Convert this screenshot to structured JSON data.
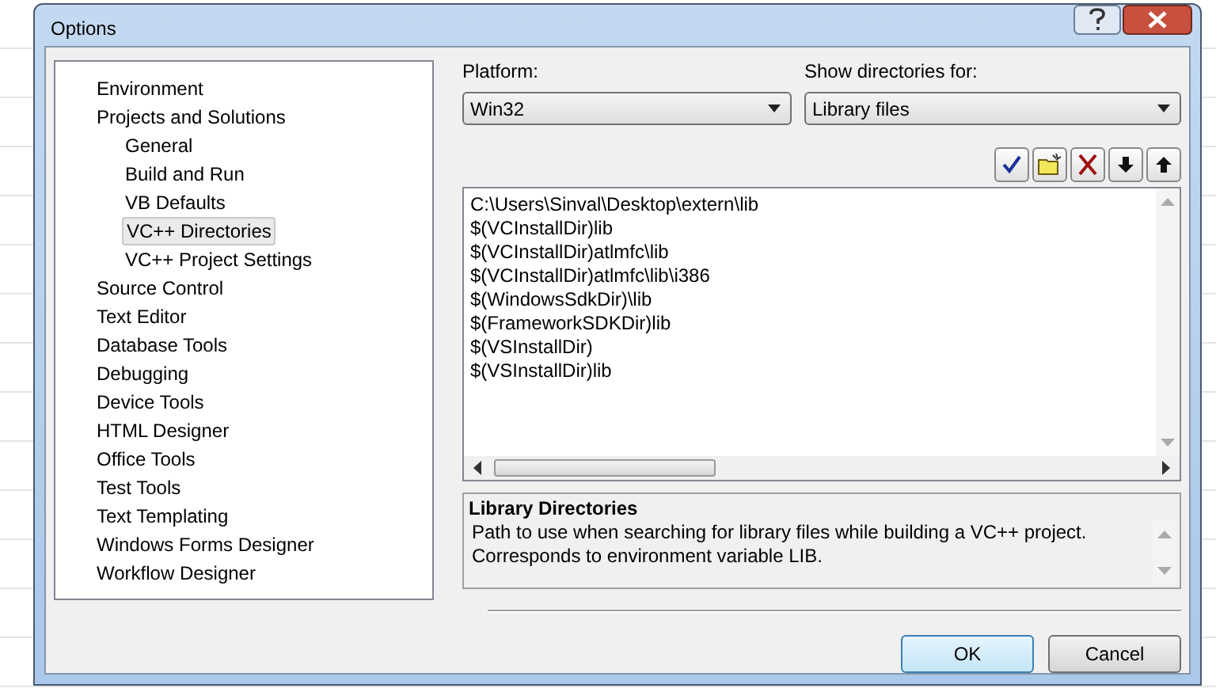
{
  "window": {
    "title": "Options"
  },
  "tree": [
    {
      "label": "Environment",
      "selected": false
    },
    {
      "label": "Projects and Solutions",
      "selected": false,
      "children": [
        {
          "label": "General",
          "selected": false
        },
        {
          "label": "Build and Run",
          "selected": false
        },
        {
          "label": "VB Defaults",
          "selected": false
        },
        {
          "label": "VC++ Directories",
          "selected": true
        },
        {
          "label": "VC++ Project Settings",
          "selected": false
        }
      ]
    },
    {
      "label": "Source Control",
      "selected": false
    },
    {
      "label": "Text Editor",
      "selected": false
    },
    {
      "label": "Database Tools",
      "selected": false
    },
    {
      "label": "Debugging",
      "selected": false
    },
    {
      "label": "Device Tools",
      "selected": false
    },
    {
      "label": "HTML Designer",
      "selected": false
    },
    {
      "label": "Office Tools",
      "selected": false
    },
    {
      "label": "Test Tools",
      "selected": false
    },
    {
      "label": "Text Templating",
      "selected": false
    },
    {
      "label": "Windows Forms Designer",
      "selected": false
    },
    {
      "label": "Workflow Designer",
      "selected": false
    }
  ],
  "platform": {
    "label": "Platform:",
    "value": "Win32"
  },
  "show_directories": {
    "label": "Show directories for:",
    "value": "Library files"
  },
  "toolbar": [
    {
      "kind": "check"
    },
    {
      "kind": "folder"
    },
    {
      "kind": "delete"
    },
    {
      "kind": "down"
    },
    {
      "kind": "up"
    }
  ],
  "directories": [
    "C:\\Users\\Sinval\\Desktop\\extern\\lib",
    "$(VCInstallDir)lib",
    "$(VCInstallDir)atlmfc\\lib",
    "$(VCInstallDir)atlmfc\\lib\\i386",
    "$(WindowsSdkDir)\\lib",
    "$(FrameworkSDKDir)lib",
    "$(VSInstallDir)",
    "$(VSInstallDir)lib"
  ],
  "description": {
    "title": "Library Directories",
    "text": "Path to use when searching for library files while building a VC++ project.\nCorresponds to environment variable LIB."
  },
  "buttons": [
    {
      "label": "OK",
      "default": true
    },
    {
      "label": "Cancel",
      "default": false
    }
  ]
}
